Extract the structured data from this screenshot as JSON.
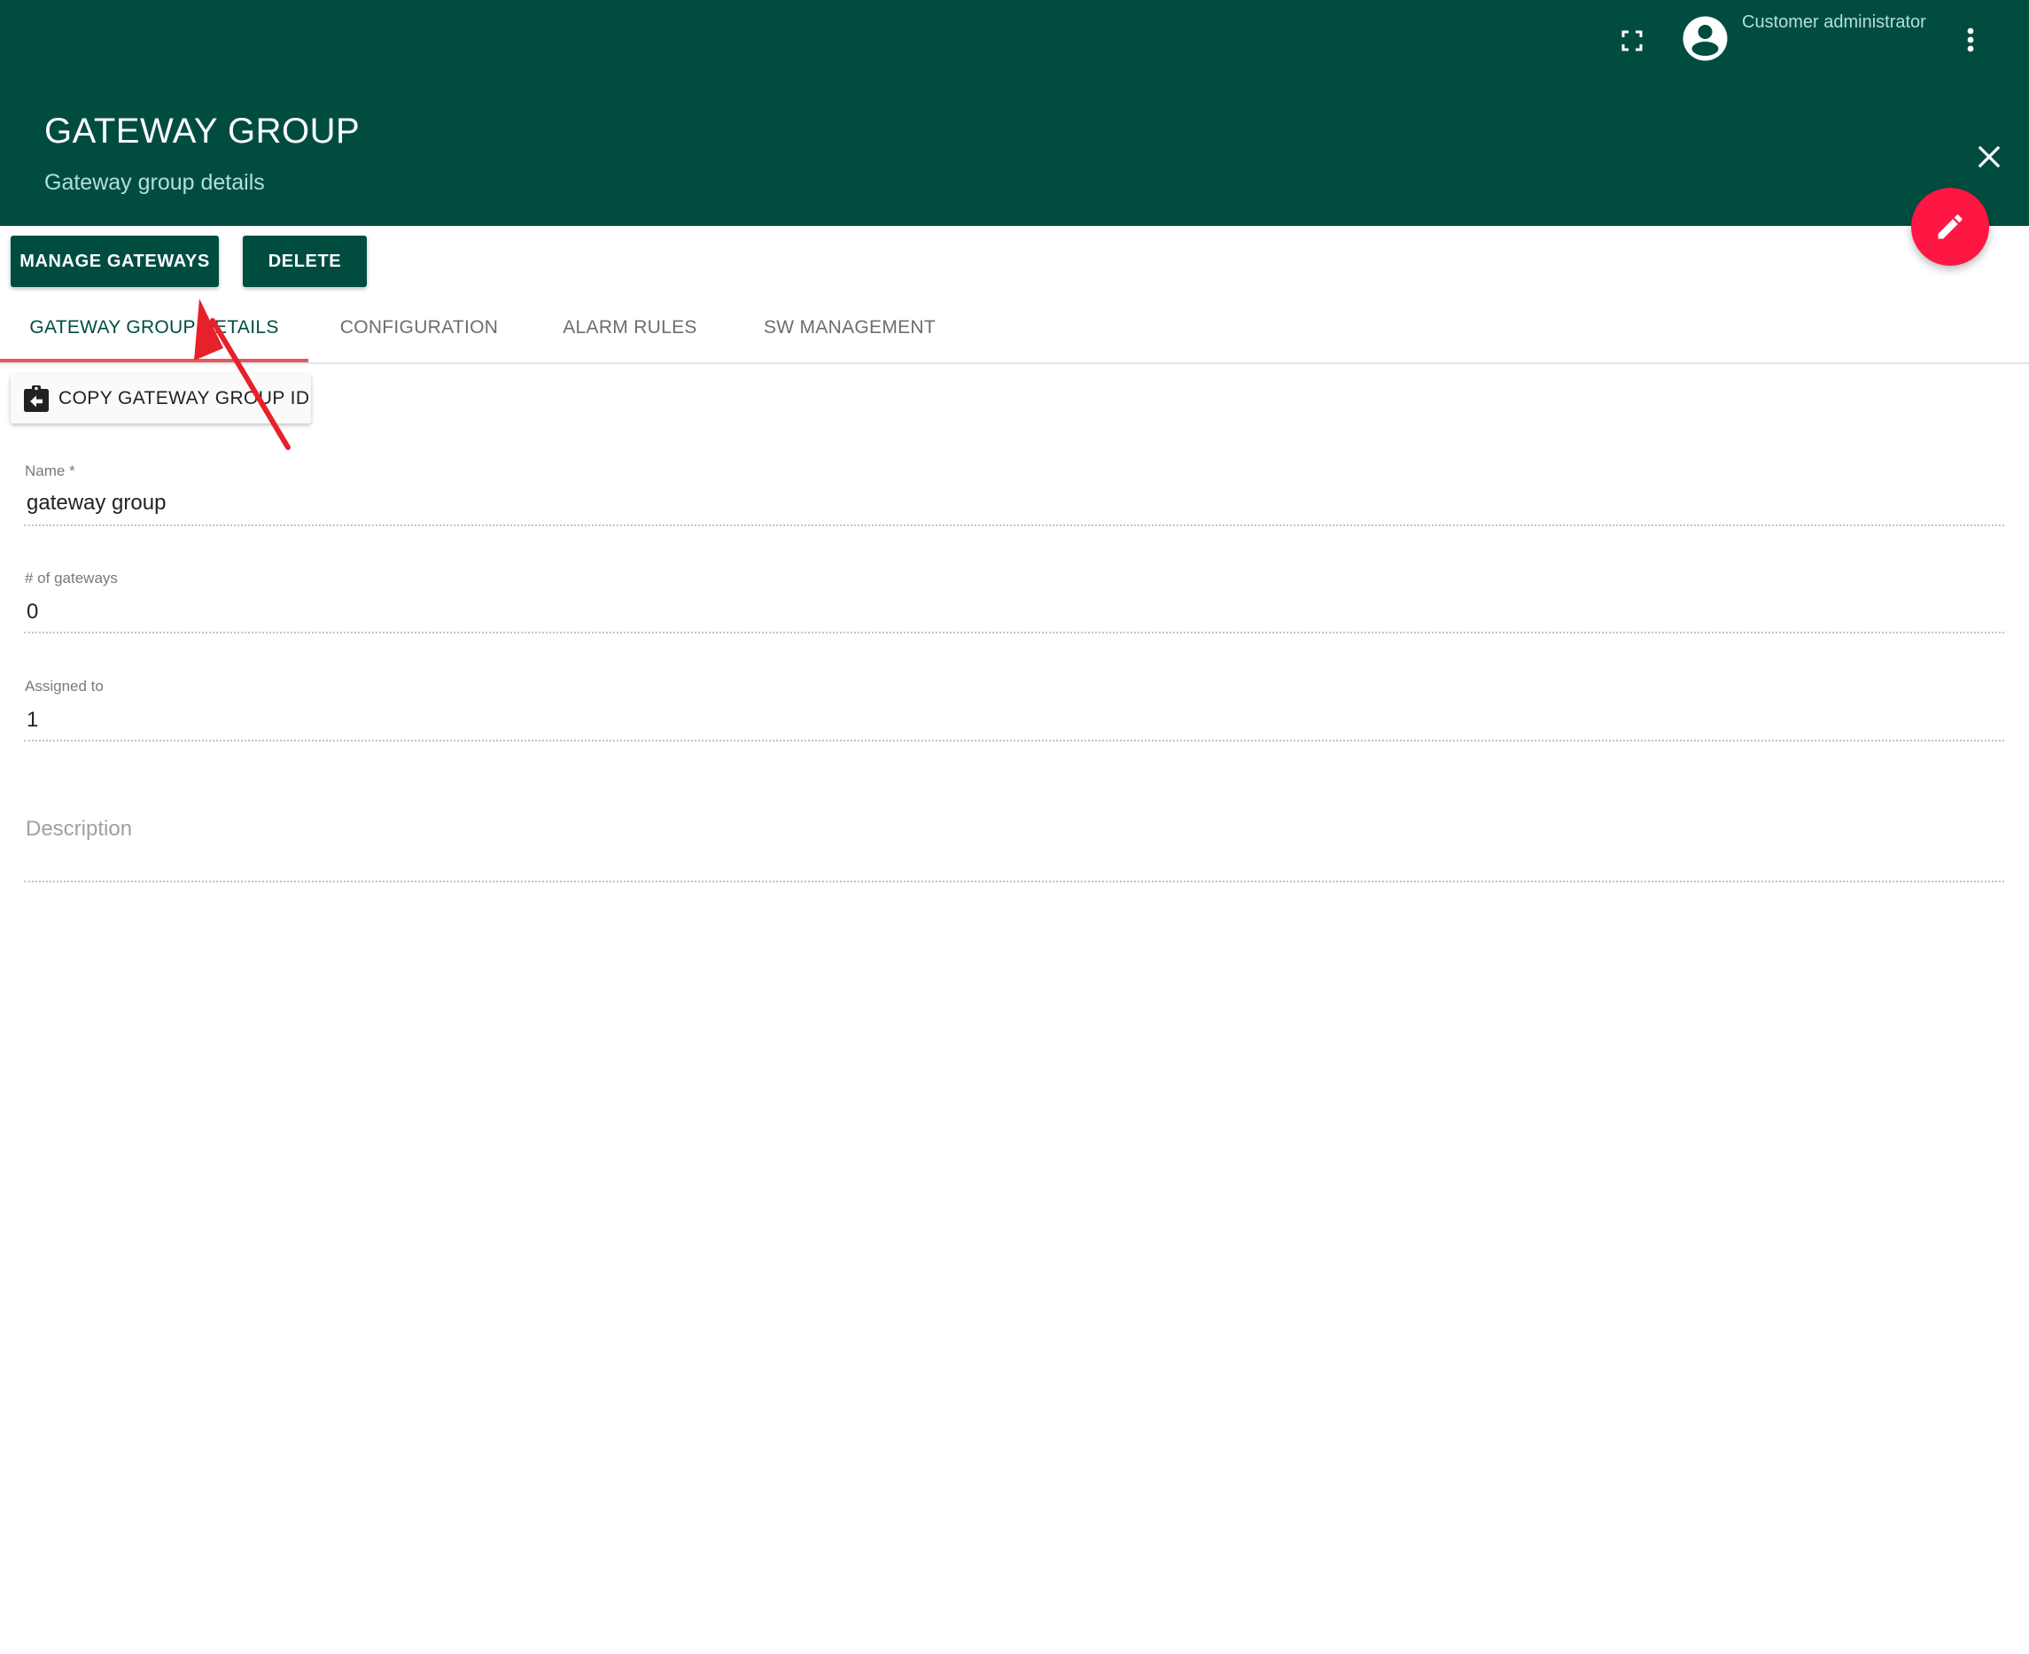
{
  "topbar": {
    "fullscreen_icon": "fullscreen-icon",
    "avatar_icon": "account-circle-icon",
    "user_name": "Customer administrator",
    "more_icon": "more-vert-icon"
  },
  "header": {
    "title": "GATEWAY GROUP",
    "subtitle": "Gateway group details",
    "close_icon": "close-icon",
    "edit_icon": "pencil-icon"
  },
  "actions": {
    "manage_gateways": "MANAGE GATEWAYS",
    "delete": "DELETE"
  },
  "tabs": [
    {
      "label": "GATEWAY GROUP DETAILS",
      "active": true
    },
    {
      "label": "CONFIGURATION",
      "active": false
    },
    {
      "label": "ALARM RULES",
      "active": false
    },
    {
      "label": "SW MANAGEMENT",
      "active": false
    }
  ],
  "copy_button": {
    "icon": "assignment-return-icon",
    "label": "COPY GATEWAY GROUP ID"
  },
  "form": {
    "name": {
      "label": "Name *",
      "value": "gateway group"
    },
    "gateway_count": {
      "label": "# of gateways",
      "value": "0"
    },
    "assigned_to": {
      "label": "Assigned to",
      "value": "1"
    },
    "description": {
      "placeholder": "Description",
      "value": ""
    }
  },
  "colors": {
    "primary": "#004d40",
    "accent": "#ff1744",
    "tab_ink": "#e05a5f",
    "annotation_arrow": "#e8202a"
  }
}
